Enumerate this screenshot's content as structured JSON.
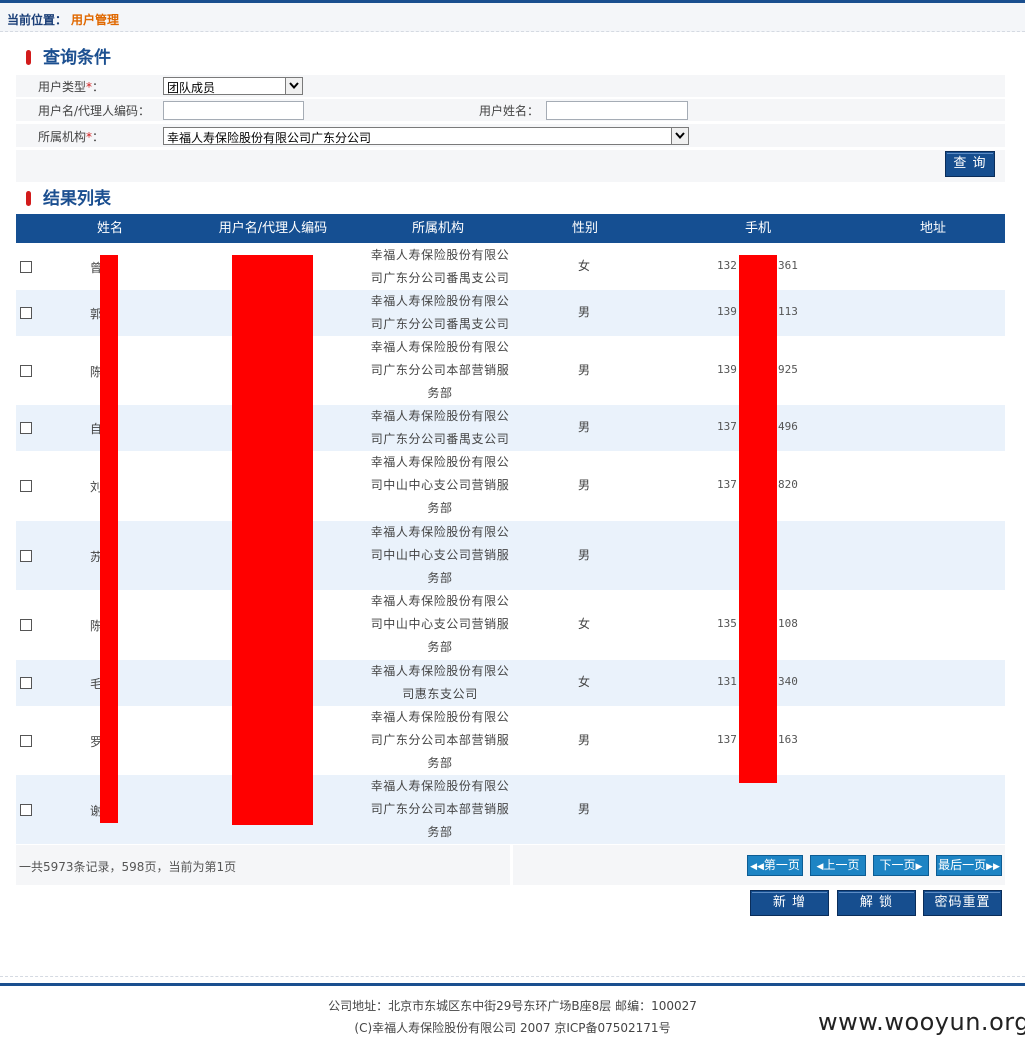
{
  "breadcrumb": {
    "label": "当前位置：",
    "current": "用户管理"
  },
  "query": {
    "title": "查询条件",
    "user_type_label": "用户类型",
    "user_type_value": "团队成员",
    "username_label": "用户名/代理人编码：",
    "username_value": "",
    "realname_label": "用户姓名：",
    "realname_value": "",
    "org_label": "所属机构",
    "org_value": "幸福人寿保险股份有限公司广东分公司",
    "required_mark": "*",
    "colon": "：",
    "search_button": "查 询"
  },
  "results": {
    "title": "结果列表",
    "columns": [
      "姓名",
      "用户名/代理人编码",
      "所属机构",
      "性别",
      "手机",
      "地址"
    ],
    "rows": [
      {
        "name": "曾    英",
        "org": "幸福人寿保险股份有限公司广东分公司番禺支公司",
        "gender": "女",
        "phone_start": "132",
        "phone_end": "361"
      },
      {
        "name": "郭    辉",
        "org": "幸福人寿保险股份有限公司广东分公司番禺支公司",
        "gender": "男",
        "phone_start": "139",
        "phone_end": "113"
      },
      {
        "name": "陈    明",
        "org": "幸福人寿保险股份有限公司广东分公司本部营销服务部",
        "gender": "男",
        "phone_start": "139",
        "phone_end": "925"
      },
      {
        "name": "自    东",
        "org": "幸福人寿保险股份有限公司广东分公司番禺支公司",
        "gender": "男",
        "phone_start": "137",
        "phone_end": "496"
      },
      {
        "name": "刘    基",
        "org": "幸福人寿保险股份有限公司中山中心支公司营销服务部",
        "gender": "男",
        "phone_start": "137",
        "phone_end": "820"
      },
      {
        "name": "苏    辉",
        "org": "幸福人寿保险股份有限公司中山中心支公司营销服务部",
        "gender": "男",
        "phone_start": "",
        "phone_end": ""
      },
      {
        "name": "陈    群",
        "org": "幸福人寿保险股份有限公司中山中心支公司营销服务部",
        "gender": "女",
        "phone_start": "135",
        "phone_end": "108"
      },
      {
        "name": "毛    文",
        "org": "幸福人寿保险股份有限公司惠东支公司",
        "gender": "女",
        "phone_start": "131",
        "phone_end": "340"
      },
      {
        "name": "罗    锋",
        "org": "幸福人寿保险股份有限公司广东分公司本部营销服务部",
        "gender": "男",
        "phone_start": "137",
        "phone_end": "163"
      },
      {
        "name": "谢    鹏",
        "org": "幸福人寿保险股份有限公司广东分公司本部营销服务部",
        "gender": "男",
        "phone_start": "",
        "phone_end": ""
      }
    ]
  },
  "pagination": {
    "info": "一共5973条记录，598页，当前为第1页",
    "first": "第一页",
    "prev": "上一页",
    "next": "下一页",
    "last": "最后一页"
  },
  "actions": {
    "add": "新  增",
    "unlock": "解  锁",
    "reset_password": "密码重置"
  },
  "footer": {
    "address": "公司地址：北京市东城区东中街29号东环广场B座8层 邮编：100027",
    "copyright": "(C)幸福人寿保险股份有限公司 2007 京ICP备07502171号"
  },
  "watermark": "www.wooyun.org",
  "colors": {
    "navy": "#154f92",
    "accent_orange": "#e06800",
    "required_red": "#d21b1b",
    "row_alt": "#eaf2fb",
    "pager_blue": "#1d84c4"
  },
  "icons": {
    "dropdown": "chevron-down-icon",
    "pager_first": "double-left-arrow-icon",
    "pager_prev": "left-arrow-icon",
    "pager_next": "right-arrow-icon",
    "pager_last": "double-right-arrow-icon"
  }
}
